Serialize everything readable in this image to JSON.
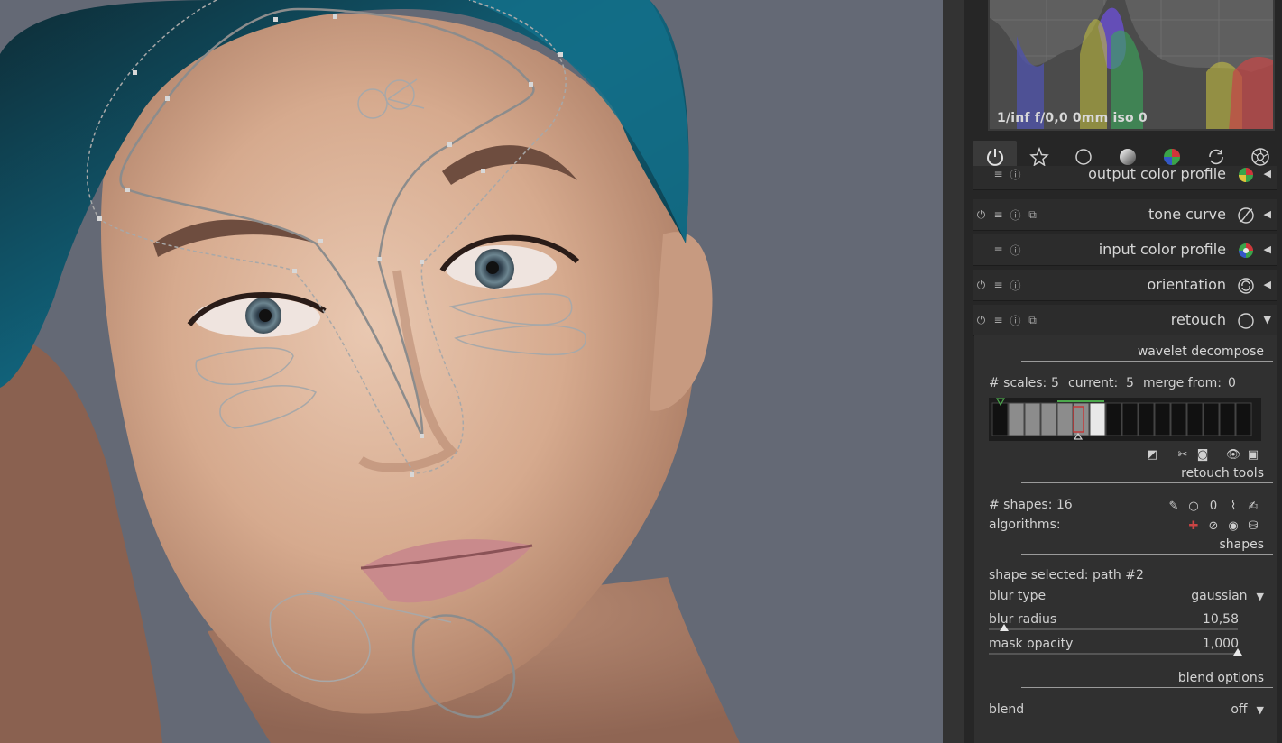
{
  "histogram": {
    "exif_info": "1/inf f/0,0 0mm iso 0"
  },
  "module_groups": [
    {
      "name": "active-modules",
      "icon": "power-icon"
    },
    {
      "name": "favourites",
      "icon": "star-icon"
    },
    {
      "name": "basic",
      "icon": "circle-icon"
    },
    {
      "name": "tone",
      "icon": "gradient-sphere-icon"
    },
    {
      "name": "color",
      "icon": "color-sphere-icon"
    },
    {
      "name": "correct",
      "icon": "refresh-icon"
    },
    {
      "name": "effect",
      "icon": "aperture-icon"
    }
  ],
  "modules": [
    {
      "title": "output color profile",
      "power": false,
      "multi": false
    },
    {
      "title": "tone curve",
      "power": true,
      "multi": true
    },
    {
      "title": "input color profile",
      "power": false,
      "multi": false
    },
    {
      "title": "orientation",
      "power": true,
      "multi": false
    },
    {
      "title": "retouch",
      "power": true,
      "multi": true
    }
  ],
  "retouch": {
    "wavelet_section": "wavelet decompose",
    "scales_label": "# scales:",
    "scales_value": "5",
    "current_label": "current:",
    "current_value": "5",
    "merge_label": "merge from:",
    "merge_value": "0",
    "retouch_tools_section": "retouch tools",
    "shapes_count_label": "# shapes: 16",
    "algorithms_label": "algorithms:",
    "shapes_section": "shapes",
    "shape_selected": "shape selected: path #2",
    "blur_type_label": "blur type",
    "blur_type_value": "gaussian",
    "blur_radius_label": "blur radius",
    "blur_radius_value": "10,58",
    "blur_radius_level": 0.06,
    "mask_opacity_label": "mask opacity",
    "mask_opacity_value": "1,000",
    "mask_opacity_level": 1.0,
    "blend_section": "blend options",
    "blend_label": "blend",
    "blend_value": "off"
  }
}
